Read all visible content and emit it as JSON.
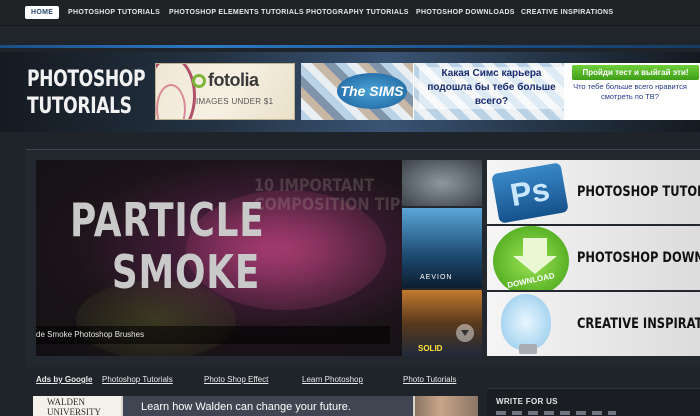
{
  "nav": {
    "items": [
      {
        "label": "HOME",
        "active": true
      },
      {
        "label": "PHOTOSHOP TUTORIALS"
      },
      {
        "label": "PHOTOSHOP ELEMENTS TUTORIALS"
      },
      {
        "label": "PHOTOGRAPHY TUTORIALS"
      },
      {
        "label": "PHOTOSHOP DOWNLOADS"
      },
      {
        "label": "CREATIVE INSPIRATIONS"
      }
    ]
  },
  "header": {
    "logo_line1": "PHOTOSHOP",
    "logo_line2": "TUTORIALS",
    "ad_fotolia": {
      "brand": "fotolia",
      "tagline": "IMAGES UNDER $1"
    },
    "ad_sims": {
      "logo": "The SIMS 3",
      "headline": "Какая Симс карьера подошла бы тебе больше всего?",
      "cta": "Пройди тест и выйгай эти!",
      "question": "Что тебе больше всего нравится смотреть по ТВ?"
    }
  },
  "slider": {
    "headline_line1": "PARTICLE",
    "headline_line2": "SMOKE",
    "ghost_line1": "10 IMPORTANT",
    "ghost_line2": "COMPOSITION TIPS",
    "caption": "de Smoke Photoshop Brushes",
    "thumb2_label": "AEVION",
    "thumb3_label": "SOLID"
  },
  "features": [
    {
      "title": "PHOTOSHOP TUTORIA",
      "icon": "Ps"
    },
    {
      "title": "PHOTOSHOP DOWNLO",
      "icon": "DOWNLOAD"
    },
    {
      "title": "CREATIVE INSPIRATIO",
      "icon": "lightbulb"
    }
  ],
  "linkbar": {
    "ads": "Ads by Google",
    "links": [
      "Photoshop Tutorials",
      "Photo Shop Effect",
      "Learn Photoshop",
      "Photo Tutorials"
    ]
  },
  "bottom_ad": {
    "brand_line1": "WALDEN",
    "brand_line2": "UNIVERSITY",
    "message": "Learn how Walden can change your future."
  },
  "right_panel": {
    "title": "WRITE FOR US"
  },
  "colors": {
    "accent_blue": "#2e7bc4",
    "nav_bg": "#202326",
    "page_bg": "#1f242b"
  }
}
